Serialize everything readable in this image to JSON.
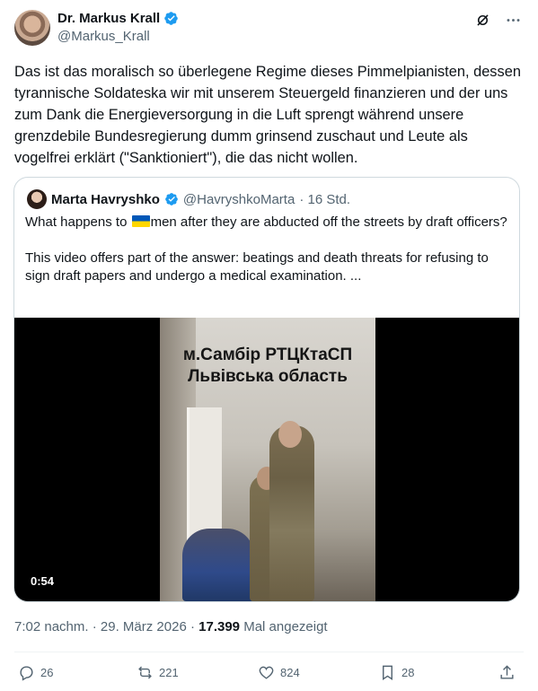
{
  "author": {
    "name": "Dr. Markus Krall",
    "handle": "@Markus_Krall"
  },
  "tweet": {
    "text": "Das ist das moralisch so überlegene Regime dieses Pimmelpianisten, dessen tyrannische Soldateska wir mit unserem Steuergeld finanzieren und der uns zum Dank die Energieversorgung in die Luft sprengt während unsere grenzdebile Bundesregierung dumm grinsend zuschaut und Leute als vogelfrei erklärt (\"Sanktioniert\"), die das nicht wollen."
  },
  "quote": {
    "name": "Marta Havryshko",
    "handle": "@HavryshkoMarta",
    "time": "· 16 Std.",
    "text_line1_pre": "What happens to ",
    "flag_icon": "ukraine-flag-icon",
    "text_line1_post": "men after they are abducted off the streets by draft officers?",
    "text_para2": "This video offers part of the answer: beatings and death threats for refusing to sign draft papers and undergo a medical examination. ...",
    "video": {
      "overlay_line1": "м.Самбір РТЦКтаСП",
      "overlay_line2": "Львівська область",
      "duration": "0:54"
    }
  },
  "meta": {
    "time": "7:02 nachm.",
    "sep1": "·",
    "date": "29. März 2026",
    "sep2": "·",
    "views": "17.399",
    "views_label": "Mal angezeigt"
  },
  "actions": {
    "replies": "26",
    "reposts": "221",
    "likes": "824",
    "bookmarks": "28"
  },
  "colors": {
    "verified": "#1d9bf0",
    "secondary_text": "#536471",
    "border": "#cfd9de"
  }
}
